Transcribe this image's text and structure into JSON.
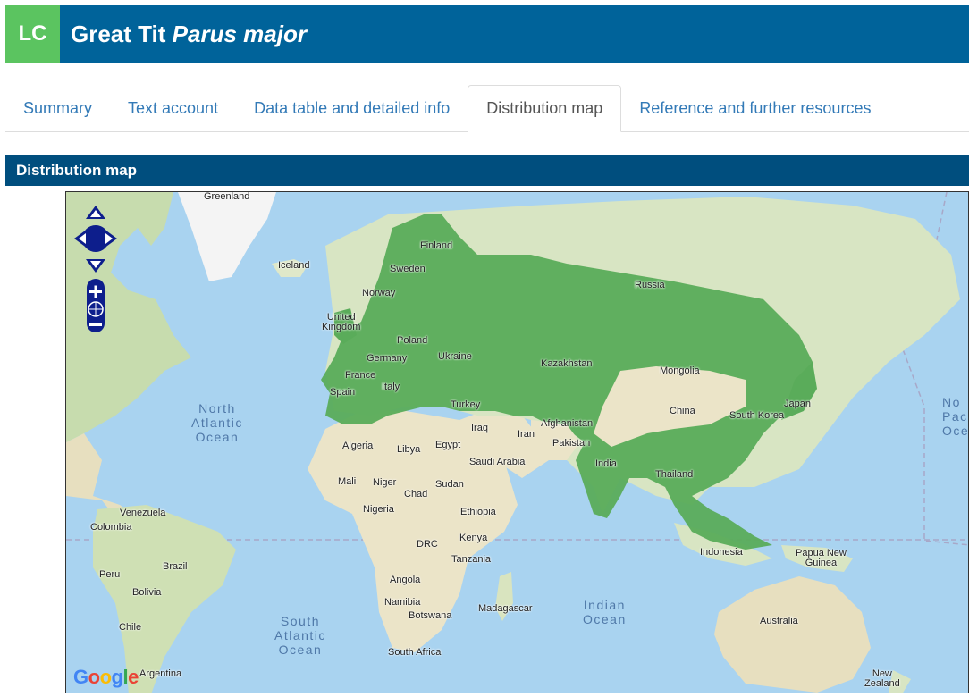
{
  "header": {
    "status_code": "LC",
    "common_name": "Great Tit",
    "scientific_name": "Parus major",
    "colors": {
      "status": "#5bc460",
      "bar": "#00639a"
    }
  },
  "tabs": [
    {
      "label": "Summary",
      "active": false
    },
    {
      "label": "Text account",
      "active": false
    },
    {
      "label": "Data table and detailed info",
      "active": false
    },
    {
      "label": "Distribution map",
      "active": true
    },
    {
      "label": "Reference and further resources",
      "active": false
    }
  ],
  "section": {
    "title": "Distribution map"
  },
  "map": {
    "range_color": "#5aac5a",
    "labels": {
      "greenland": "Greenland",
      "iceland": "Iceland",
      "finland": "Finland",
      "sweden": "Sweden",
      "norway": "Norway",
      "uk": "United\nKingdom",
      "poland": "Poland",
      "germany": "Germany",
      "ukraine": "Ukraine",
      "france": "France",
      "italy": "Italy",
      "spain": "Spain",
      "russia": "Russia",
      "kazakhstan": "Kazakhstan",
      "mongolia": "Mongolia",
      "china": "China",
      "south_korea": "South Korea",
      "japan": "Japan",
      "turkey": "Turkey",
      "iraq": "Iraq",
      "iran": "Iran",
      "afghanistan": "Afghanistan",
      "pakistan": "Pakistan",
      "india": "India",
      "thailand": "Thailand",
      "indonesia": "Indonesia",
      "papua": "Papua New\nGuinea",
      "australia": "Australia",
      "new_zealand": "New\nZealand",
      "algeria": "Algeria",
      "libya": "Libya",
      "egypt": "Egypt",
      "saudi": "Saudi Arabia",
      "mali": "Mali",
      "niger": "Niger",
      "chad": "Chad",
      "sudan": "Sudan",
      "nigeria": "Nigeria",
      "ethiopia": "Ethiopia",
      "drc": "DRC",
      "kenya": "Kenya",
      "tanzania": "Tanzania",
      "angola": "Angola",
      "namibia": "Namibia",
      "botswana": "Botswana",
      "madagascar": "Madagascar",
      "south_africa": "South Africa",
      "venezuela": "Venezuela",
      "colombia": "Colombia",
      "brazil": "Brazil",
      "peru": "Peru",
      "bolivia": "Bolivia",
      "chile": "Chile",
      "argentina": "Argentina"
    },
    "oceans": {
      "north_atlantic": "North\nAtlantic\nOcean",
      "south_atlantic": "South\nAtlantic\nOcean",
      "indian": "Indian\nOcean",
      "north_pacific": "No\nPac\nOce"
    },
    "attribution": [
      "G",
      "o",
      "o",
      "g",
      "l",
      "e"
    ]
  }
}
